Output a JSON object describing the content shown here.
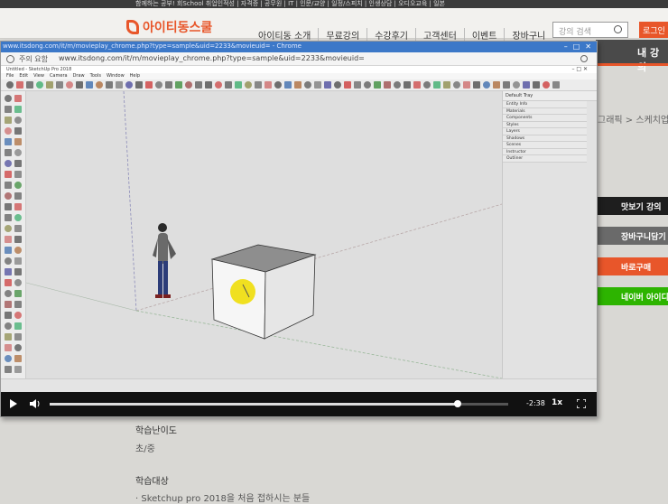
{
  "site": {
    "topstrip": "함께하는 공부! 회School   취업인적성 | 자격증 | 공무원 | IT | 인문/교양 | 일정/스피치 | 인생상담 | 오디오교육 | 일본",
    "logo": "아이티동스쿨",
    "nav": [
      "아이티동 소개",
      "무료강의",
      "수강후기",
      "고객센터",
      "이벤트",
      "장바구니"
    ],
    "search_placeholder": "강의 검색",
    "login": "로그인",
    "darkband": "내 강의",
    "breadcrumb": "그래픽 > 스케치업",
    "side_buttons": [
      {
        "label": "맛보기 강의",
        "color": "#1e1e1e"
      },
      {
        "label": "장바구니담기",
        "color": "#6a6a6a"
      },
      {
        "label": "바로구매",
        "color": "#e8562a"
      },
      {
        "label": "네이버 아이디로",
        "color": "#2db400"
      }
    ],
    "difficulty_label": "학습난이도",
    "difficulty_value": "초/중",
    "target_label": "학습대상",
    "target_value": "· Sketchup pro 2018을 처음 접하시는 분들"
  },
  "browser": {
    "tab_title": "www.itsdong.com/it/m/movieplay_chrome.php?type=sample&uid=2233&movieuid= - Chrome",
    "warning": "주의 요함",
    "url": "www.itsdong.com/it/m/movieplay_chrome.php?type=sample&uid=2233&movieuid="
  },
  "sketchup": {
    "title": "Untitled - SketchUp Pro 2018",
    "menu": [
      "File",
      "Edit",
      "View",
      "Camera",
      "Draw",
      "Tools",
      "Window",
      "Help"
    ],
    "tray_title": "Default Tray",
    "tray_items": [
      "Entity Info",
      "Materials",
      "Components",
      "Styles",
      "Layers",
      "Shadows",
      "Scenes",
      "Instructor",
      "Outliner"
    ],
    "cursor_color": "#f0e020"
  },
  "video": {
    "time": "-2:38",
    "speed": "1x",
    "progress": 0.89
  }
}
